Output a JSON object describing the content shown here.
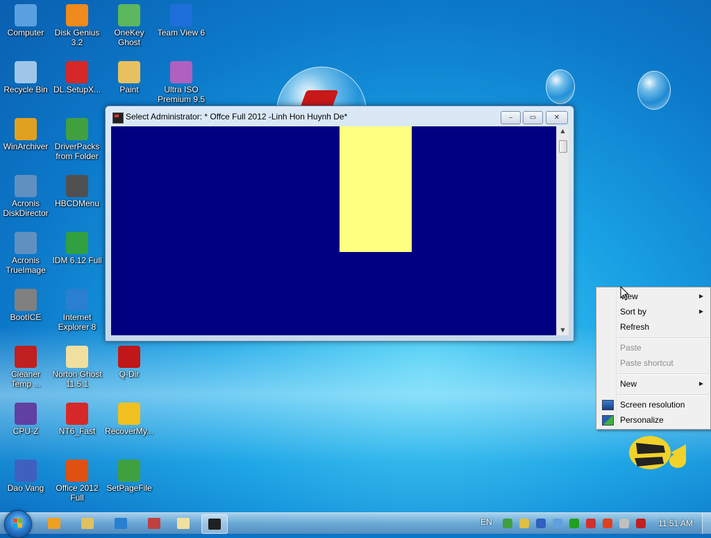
{
  "desktop": {
    "icons": [
      {
        "label": "Computer",
        "icon": "computer-icon",
        "color": "#5aa0e0"
      },
      {
        "label": "Disk Genius 3.2",
        "icon": "disk-genius-icon",
        "color": "#f08a1a"
      },
      {
        "label": "OneKey Ghost",
        "icon": "onekey-ghost-icon",
        "color": "#5cb85c"
      },
      {
        "label": "Team View 6",
        "icon": "teamviewer-icon",
        "color": "#1e6fd9"
      },
      {
        "label": "Recycle Bin",
        "icon": "recycle-bin-icon",
        "color": "#9fc6e8"
      },
      {
        "label": "DL.SetupX...",
        "icon": "dlsetup-icon",
        "color": "#d62828"
      },
      {
        "label": "Paint",
        "icon": "paint-icon",
        "color": "#e8c060"
      },
      {
        "label": "Ultra ISO Premium 9.5",
        "icon": "ultraiso-icon",
        "color": "#b060c0"
      },
      {
        "label": "WinArchiver",
        "icon": "winarchiver-icon",
        "color": "#e0a020"
      },
      {
        "label": "DriverPacks from Folder",
        "icon": "driverpacks-icon",
        "color": "#40a040"
      },
      {
        "label": "Acronis DiskDirector",
        "icon": "acronis-diskdirector-icon",
        "color": "#6090c0"
      },
      {
        "label": "HBCDMenu",
        "icon": "hbcdmenu-icon",
        "color": "#505050"
      },
      {
        "label": "Acronis TrueImage",
        "icon": "acronis-trueimage-icon",
        "color": "#6090c0"
      },
      {
        "label": "IDM 6.12 Full",
        "icon": "idm-icon",
        "color": "#30a040"
      },
      {
        "label": "BootICE",
        "icon": "bootice-icon",
        "color": "#808080"
      },
      {
        "label": "Internet Explorer 8",
        "icon": "internet-explorer-icon",
        "color": "#2a7fd0"
      },
      {
        "label": "Cleaner Temp ...",
        "icon": "cleaner-icon",
        "color": "#c02020"
      },
      {
        "label": "Norton Ghost 11.5.1",
        "icon": "norton-ghost-icon",
        "color": "#f0e0a0"
      },
      {
        "label": "Q-Dir",
        "icon": "qdir-icon",
        "color": "#c01818"
      },
      {
        "label": "CPU-Z",
        "icon": "cpuz-icon",
        "color": "#6040a0"
      },
      {
        "label": "NT6_Fast",
        "icon": "nt6fast-icon",
        "color": "#d62828"
      },
      {
        "label": "RecoverMy...",
        "icon": "recovermyfiles-icon",
        "color": "#f0c020"
      },
      {
        "label": "Dao Vang",
        "icon": "daovang-icon",
        "color": "#4060c0"
      },
      {
        "label": "Office 2012 Full",
        "icon": "office-icon",
        "color": "#e05010"
      },
      {
        "label": "SetPageFile",
        "icon": "setpagefile-icon",
        "color": "#40a040"
      }
    ]
  },
  "console_window": {
    "title": "Select Administrator:  * Offce Full 2012 -Linh Hon Huynh De*",
    "minimize_glyph": "–",
    "maximize_glyph": "▭",
    "close_glyph": "✕",
    "scroll_up": "▲",
    "scroll_down": "▼",
    "background_color": "#000080",
    "cursor_block_color": "#ffff80"
  },
  "context_menu": {
    "items": [
      {
        "label": "View",
        "submenu": true,
        "disabled": false
      },
      {
        "label": "Sort by",
        "submenu": true,
        "disabled": false
      },
      {
        "label": "Refresh",
        "submenu": false,
        "disabled": false
      },
      {
        "label": "Paste",
        "submenu": false,
        "disabled": true
      },
      {
        "label": "Paste shortcut",
        "submenu": false,
        "disabled": true
      },
      {
        "label": "New",
        "submenu": true,
        "disabled": false
      },
      {
        "label": "Screen resolution",
        "submenu": false,
        "disabled": false,
        "icon": "screen-resolution-icon"
      },
      {
        "label": "Personalize",
        "submenu": false,
        "disabled": false,
        "icon": "personalize-icon"
      }
    ],
    "arrow_glyph": "▶"
  },
  "taskbar": {
    "pinned": [
      {
        "icon": "media-player-icon",
        "color": "#f0a020"
      },
      {
        "icon": "file-explorer-icon",
        "color": "#e0c060"
      },
      {
        "icon": "internet-explorer-icon",
        "color": "#2a7fd0"
      },
      {
        "icon": "network-icon",
        "color": "#c04040"
      },
      {
        "icon": "norton-ghost-icon",
        "color": "#f0e0a0"
      },
      {
        "icon": "command-prompt-icon",
        "color": "#202020",
        "active": true
      }
    ],
    "language": "EN",
    "tray_icons": [
      {
        "icon": "globe-tray-icon",
        "color": "#40a040"
      },
      {
        "icon": "stack-tray-icon",
        "color": "#e0c040"
      },
      {
        "icon": "device-tray-icon",
        "color": "#3060c0"
      },
      {
        "icon": "hardware-tray-icon",
        "color": "#60a0e0"
      },
      {
        "icon": "play-tray-icon",
        "color": "#20a020"
      },
      {
        "icon": "shield-tray-icon",
        "color": "#d03030"
      },
      {
        "icon": "flag-tray-icon",
        "color": "#e04020"
      },
      {
        "icon": "screen-tray-icon",
        "color": "#c0c0c0"
      },
      {
        "icon": "volume-muted-icon",
        "color": "#c02020"
      }
    ],
    "clock": "11:51 AM"
  }
}
